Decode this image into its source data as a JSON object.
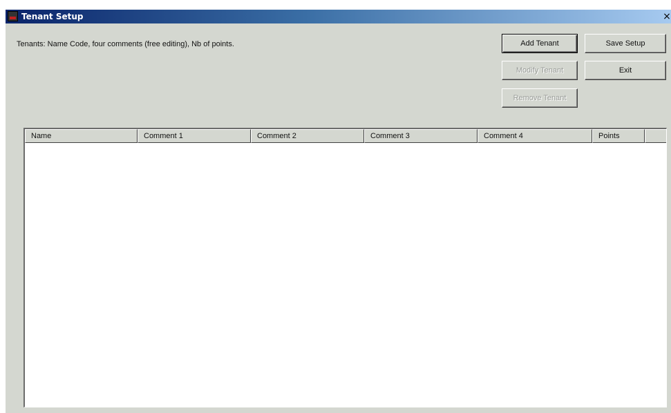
{
  "window": {
    "title": "Tenant Setup",
    "close_glyph": "×"
  },
  "description": "Tenants: Name Code, four comments (free editing), Nb of points.",
  "buttons": {
    "add_tenant": "Add Tenant",
    "save_setup": "Save Setup",
    "modify_tenant": "Modify Tenant",
    "exit": "Exit",
    "remove_tenant": "Remove Tenant"
  },
  "table": {
    "columns": [
      "Name",
      "Comment 1",
      "Comment 2",
      "Comment 3",
      "Comment 4",
      "Points",
      ""
    ],
    "rows": []
  },
  "icons": {
    "app": "app-icon",
    "close": "close-icon"
  },
  "colors": {
    "title_bar_start": "#0a246a",
    "title_bar_end": "#a6caf0",
    "dialog_bg": "#d4d7d0",
    "disabled_text": "#9a9d99"
  }
}
